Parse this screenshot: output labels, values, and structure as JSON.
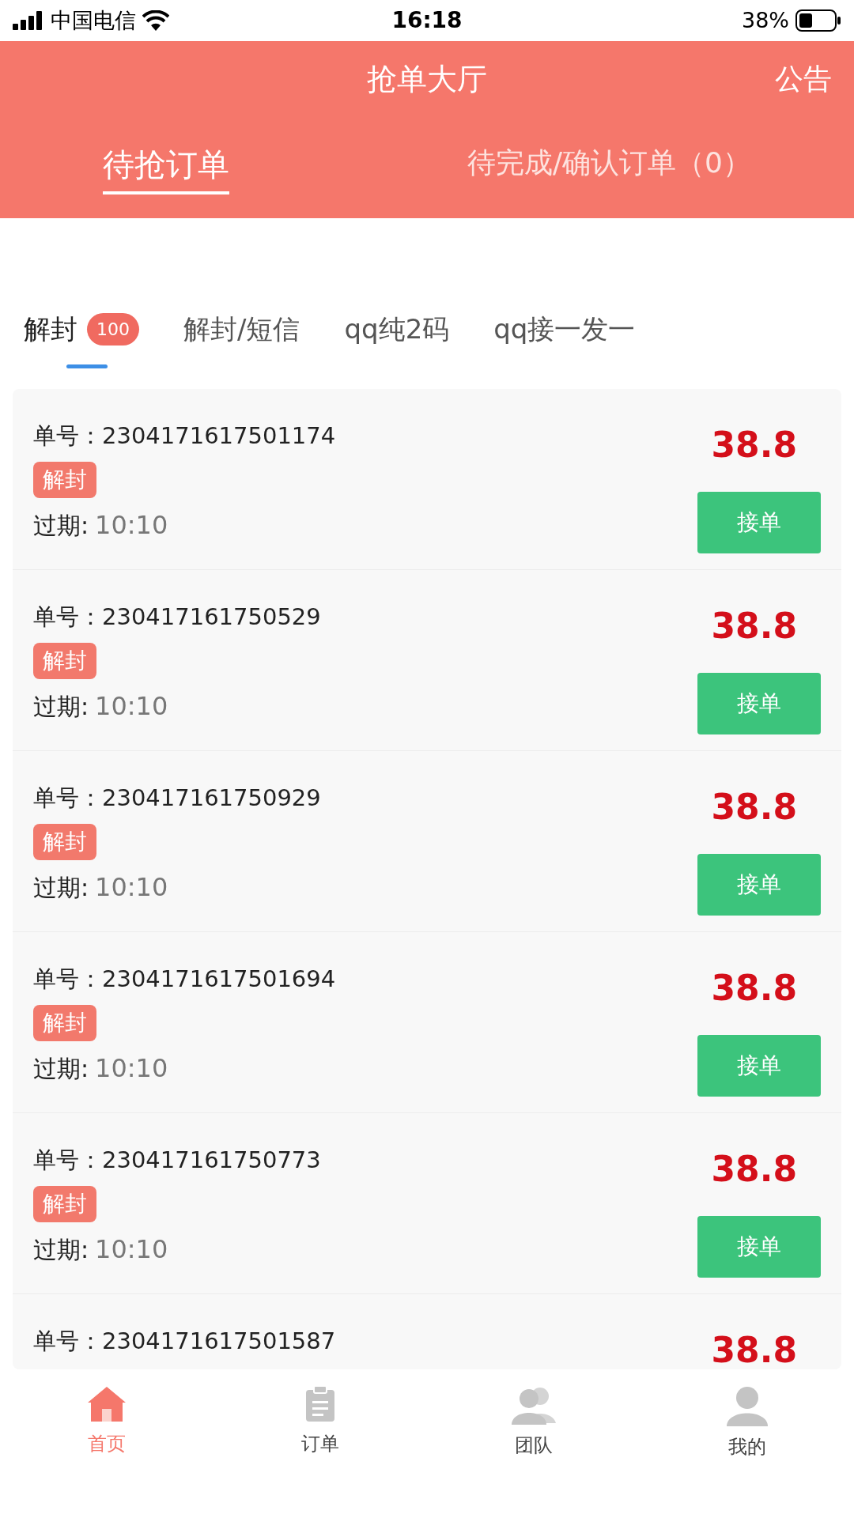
{
  "status_bar": {
    "carrier": "中国电信",
    "time": "16:18",
    "battery": "38%"
  },
  "header": {
    "title": "抢单大厅",
    "action": "公告"
  },
  "tabs": [
    {
      "label": "待抢订单",
      "selected": true
    },
    {
      "label": "待完成/确认订单（0）",
      "selected": false
    }
  ],
  "categories": [
    {
      "label": "解封",
      "badge": "100",
      "selected": true
    },
    {
      "label": "解封/短信",
      "selected": false
    },
    {
      "label": "qq纯2码",
      "selected": false
    },
    {
      "label": "qq接一发一",
      "selected": false
    }
  ],
  "orders": [
    {
      "number": "单号：2304171617501174",
      "price": "38.8",
      "tag": "解封",
      "expiry_label": "过期:",
      "expiry": "10:10",
      "button": "接单"
    },
    {
      "number": "单号：230417161750529",
      "price": "38.8",
      "tag": "解封",
      "expiry_label": "过期:",
      "expiry": "10:10",
      "button": "接单"
    },
    {
      "number": "单号：230417161750929",
      "price": "38.8",
      "tag": "解封",
      "expiry_label": "过期:",
      "expiry": "10:10",
      "button": "接单"
    },
    {
      "number": "单号：2304171617501694",
      "price": "38.8",
      "tag": "解封",
      "expiry_label": "过期:",
      "expiry": "10:10",
      "button": "接单"
    },
    {
      "number": "单号：230417161750773",
      "price": "38.8",
      "tag": "解封",
      "expiry_label": "过期:",
      "expiry": "10:10",
      "button": "接单"
    },
    {
      "number": "单号：2304171617501587",
      "price": "38.8"
    }
  ],
  "bottom_nav": [
    {
      "kind": "home",
      "label": "首页",
      "selected": true
    },
    {
      "kind": "orders",
      "label": "订单",
      "selected": false
    },
    {
      "kind": "team",
      "label": "团队",
      "selected": false
    },
    {
      "kind": "profile",
      "label": "我的",
      "selected": false
    }
  ]
}
